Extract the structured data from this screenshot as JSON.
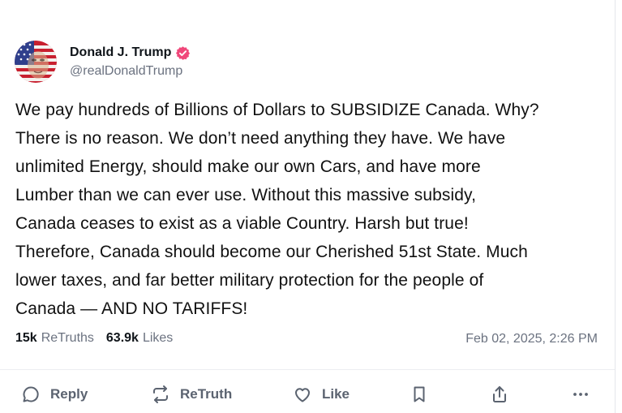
{
  "post": {
    "author": {
      "display_name": "Donald J. Trump",
      "handle": "@realDonaldTrump",
      "verified_color": "#f0477a"
    },
    "text": "We pay hundreds of Billions of Dollars to SUBSIDIZE Canada. Why?\nThere is no reason. We don’t need anything they have. We have\nunlimited Energy, should make our own Cars, and have more\nLumber than we can ever use. Without this massive subsidy,\nCanada ceases to exist as a viable Country. Harsh but true!\nTherefore, Canada should become our Cherished 51st State. Much\nlower taxes, and far better military protection for the people of\nCanada — AND NO TARIFFS!",
    "stats": {
      "retruths_count": "15k",
      "retruths_label": "ReTruths",
      "likes_count": "63.9k",
      "likes_label": "Likes"
    },
    "timestamp": "Feb 02, 2025, 2:26 PM"
  },
  "actions": {
    "reply_label": "Reply",
    "retruth_label": "ReTruth",
    "like_label": "Like",
    "bookmark_icon": "bookmark-icon",
    "share_icon": "share-icon",
    "more_icon": "more-icon"
  },
  "colors": {
    "text": "#0f1419",
    "muted": "#6b7280",
    "action": "#5b6370",
    "verified": "#f0477a"
  }
}
